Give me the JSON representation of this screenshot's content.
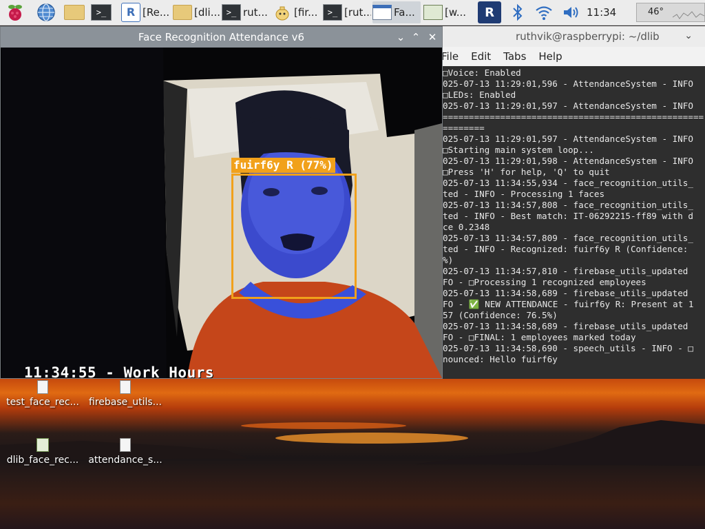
{
  "taskbar": {
    "tasks": [
      {
        "label": "[Re...",
        "icon": "vnc-icon"
      },
      {
        "label": "[dli...",
        "icon": "folder-icon"
      },
      {
        "label": "rut...",
        "icon": "terminal-icon"
      },
      {
        "label": "[fir...",
        "icon": "teapot-icon"
      },
      {
        "label": "[rut...",
        "icon": "terminal-icon"
      },
      {
        "label": "Fa...",
        "icon": "window-icon"
      },
      {
        "label": "[w...",
        "icon": "image-icon"
      }
    ],
    "clock": "11:34",
    "cpu_temp": "46°",
    "accent": "#3d6fb8"
  },
  "face_window": {
    "title": "Face Recognition Attendance v6",
    "overlay_time": "11:34:55 - Work Hours",
    "face_label": "fuirf6y R (77%)",
    "box_color": "#f1a11b"
  },
  "terminal_window": {
    "title": "ruthvik@raspberrypi: ~/dlib",
    "menu": [
      "File",
      "Edit",
      "Tabs",
      "Help"
    ],
    "lines": [
      "□Voice: Enabled",
      "025-07-13 11:29:01,596 - AttendanceSystem - INFO",
      "□LEDs: Enabled",
      "025-07-13 11:29:01,597 - AttendanceSystem - INFO",
      "==================================================",
      "========",
      "025-07-13 11:29:01,597 - AttendanceSystem - INFO",
      "□Starting main system loop...",
      "025-07-13 11:29:01,598 - AttendanceSystem - INFO",
      "□Press 'H' for help, 'Q' to quit",
      "025-07-13 11:34:55,934 - face_recognition_utils_",
      "ted - INFO - Processing 1 faces",
      "025-07-13 11:34:57,808 - face_recognition_utils_",
      "ted - INFO - Best match: IT-06292215-ff89 with d",
      "ce 0.2348",
      "025-07-13 11:34:57,809 - face_recognition_utils_",
      "ted - INFO - Recognized: fuirf6y R (Confidence:",
      "%)",
      "025-07-13 11:34:57,810 - firebase_utils_updated",
      "FO - □Processing 1 recognized employees",
      "025-07-13 11:34:58,689 - firebase_utils_updated",
      "FO - ✅ NEW ATTENDANCE - fuirf6y R: Present at 1",
      "57 (Confidence: 76.5%)",
      "025-07-13 11:34:58,689 - firebase_utils_updated",
      "FO - □FINAL: 1 employees marked today",
      "025-07-13 11:34:58,690 - speech_utils - INFO - □",
      "nounced: Hello fuirf6y"
    ]
  },
  "desktop_icons": [
    {
      "label": "test_face_rec...",
      "icon": "text-file-icon"
    },
    {
      "label": "firebase_utils...",
      "icon": "text-file-icon"
    },
    {
      "label": "dlib_face_rec...",
      "icon": "image-file-icon"
    },
    {
      "label": "attendance_s...",
      "icon": "text-file-icon"
    }
  ]
}
